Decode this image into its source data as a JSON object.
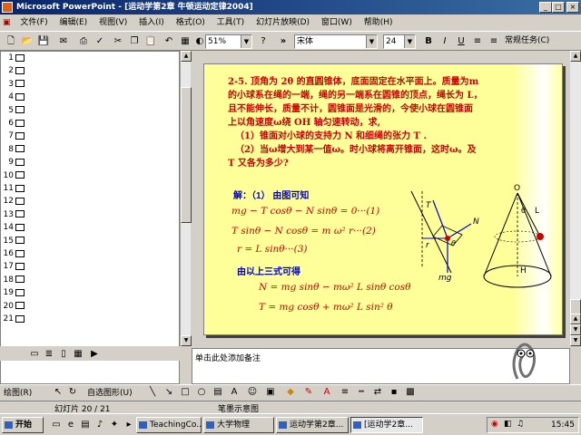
{
  "window": {
    "title": "Microsoft PowerPoint - [运动学第2章 牛顿运动定律2004]"
  },
  "menu": [
    "文件(F)",
    "编辑(E)",
    "视图(V)",
    "插入(I)",
    "格式(O)",
    "工具(T)",
    "幻灯片放映(D)",
    "窗口(W)",
    "帮助(H)"
  ],
  "toolbar": {
    "zoom": "51%",
    "font": "宋体",
    "font_size": "24",
    "task_pane": "常规任务(C)"
  },
  "outline": {
    "slide_numbers": [
      "1",
      "2",
      "3",
      "4",
      "5",
      "6",
      "7",
      "8",
      "9",
      "10",
      "11",
      "12",
      "13",
      "14",
      "15",
      "16",
      "17",
      "18",
      "19",
      "20",
      "21"
    ]
  },
  "slide": {
    "problem_lines": [
      "2-5. 顶角为 2θ 的直圆锥体，底面固定在水平面上。质量为m",
      "的小球系在绳的一端，绳的另一端系在圆锥的顶点，绳长为 L，",
      "且不能伸长，质量不计，圆锥面是光滑的，今使小球在圆锥面",
      "上以角速度ω绕 OH 轴匀速转动，求,"
    ],
    "q1": "（1）锥面对小球的支持力 N 和细绳的张力 T .",
    "q2a": "（2）当ω增大到某一值ω。时小球将离开锥面，这时ω。及",
    "q2b": "T 又各为多少?",
    "solution_label": "解：（1）  由图可知",
    "eq1": "mg − T cosθ − N sinθ = 0···(1)",
    "eq2": "T sinθ − N cosθ = m ω² r···(2)",
    "eq3": "r = L sinθ···(3)",
    "combine_label": "由以上三式可得",
    "eq4": "N = mg sinθ − mω² L sinθ cosθ",
    "eq5": "T = mg cosθ + mω² L sin² θ",
    "fig_labels": {
      "T": "T",
      "N": "N",
      "mg": "mg",
      "r": "r",
      "O": "O",
      "L": "L",
      "H": "H",
      "theta": "θ"
    }
  },
  "notes": {
    "placeholder": "单击此处添加备注"
  },
  "drawbar": {
    "draw": "绘图(R)",
    "autoshapes": "自选图形(U)"
  },
  "status": {
    "slide_info": "幻灯片 20 / 21",
    "design": "笔墨示意图"
  },
  "taskbar": {
    "start": "开始",
    "tasks": [
      "TeachingCo...",
      "大学物理",
      "运动学第2章...",
      "[运动学2章..."
    ],
    "clock": "15:45"
  }
}
